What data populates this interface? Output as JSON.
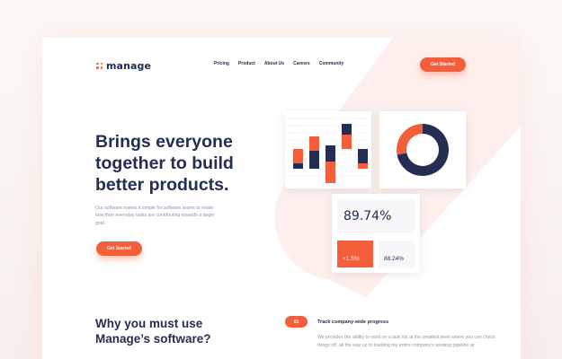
{
  "brand": {
    "name": "manage",
    "accent_color": "#f25f3a",
    "navy_color": "#242d52",
    "muted_text_color": "#9095a7"
  },
  "nav": {
    "items": [
      {
        "label": "Pricing"
      },
      {
        "label": "Product"
      },
      {
        "label": "About Us"
      },
      {
        "label": "Careers"
      },
      {
        "label": "Community"
      }
    ],
    "cta_label": "Get Started"
  },
  "hero": {
    "title_lines": [
      "Brings everyone",
      "together to build",
      "better products."
    ],
    "description": "Our software makes it simple for software teams to relate how their everyday tasks are contributing towards a larger goal.",
    "cta_label": "Get Started"
  },
  "dashboard": {
    "bar_colors": [
      "#f25f3a",
      "#242d52"
    ],
    "donut_colors": [
      "#242d52",
      "#f25f3a"
    ],
    "donut_share": 0.72,
    "stat_main": "89.74%",
    "stat_delta": "+1.5%",
    "stat_secondary": "88.24%"
  },
  "why": {
    "title_lines": [
      "Why you must use",
      "Manage’s software?"
    ],
    "feature": {
      "number": "01",
      "title": "Track company-wide progress",
      "description": "We provides the ability to work on a task list at the smallest level where you can check things off, all the way up to tracking my entire company's working pipeline at"
    }
  }
}
